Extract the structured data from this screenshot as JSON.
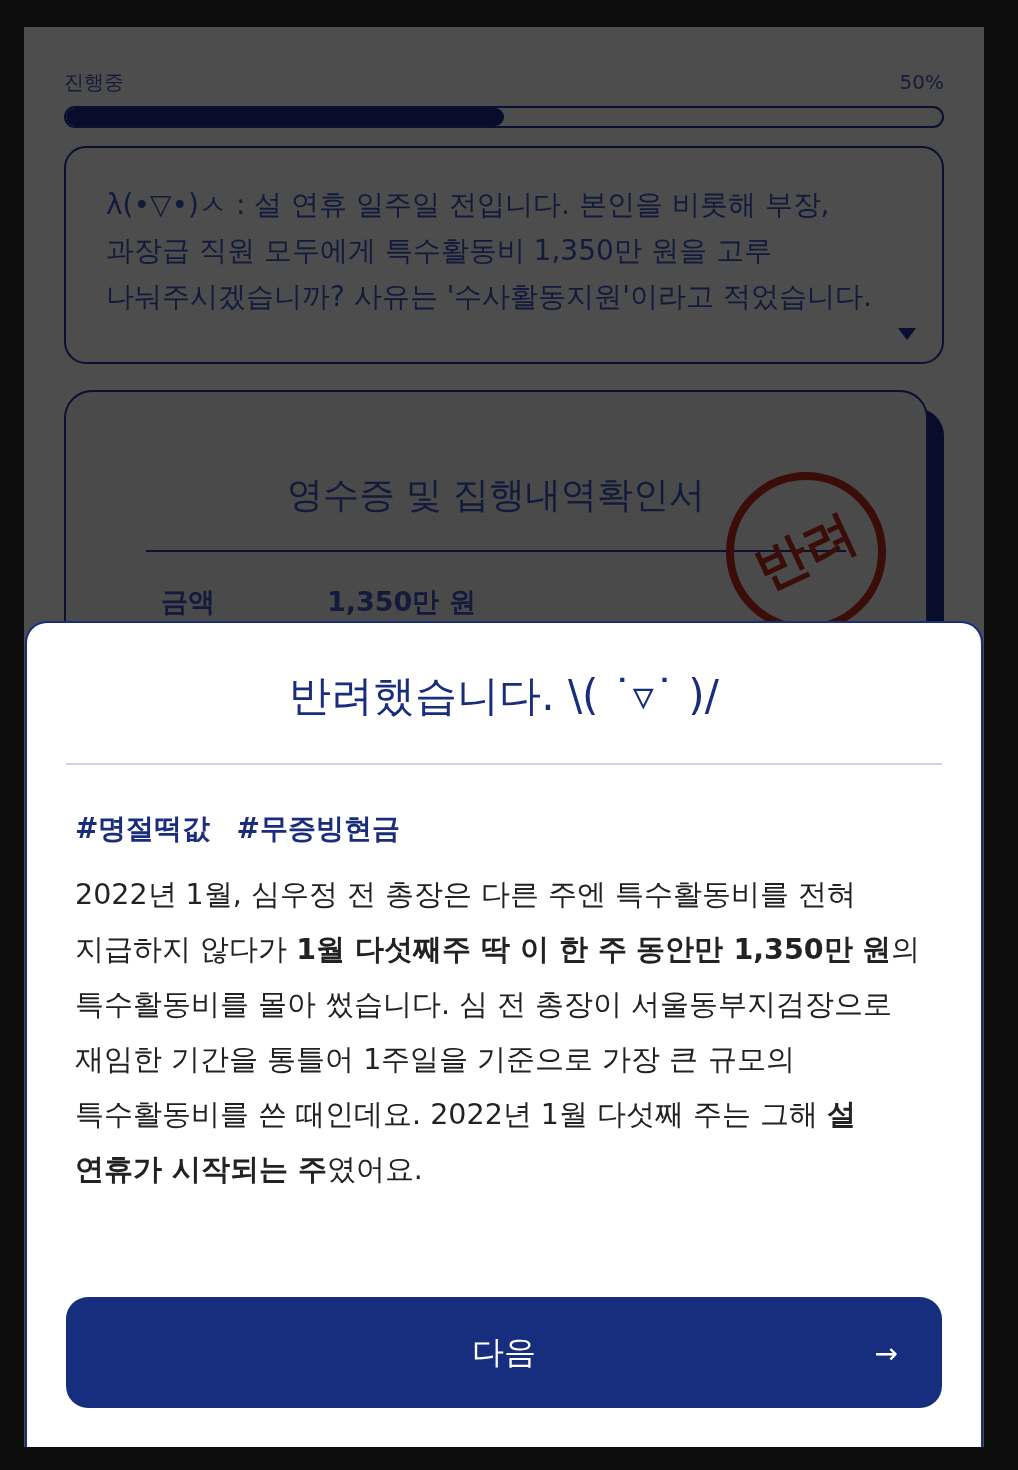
{
  "progress": {
    "label": "진행중",
    "reading": "50%",
    "level": 0.5
  },
  "dialog": {
    "text": "λ(•▽•)ㅅ : 설 연휴 일주일 전입니다. 본인을 비롯해 부장, 과장급 직원 모두에게 특수활동비 1,350만 원을 고루 나눠주시겠습니까? 사유는 '수사활동지원'이라고 적었습니다."
  },
  "receipt": {
    "title": "영수증 및 집행내역확인서",
    "rows": [
      {
        "label": "금액",
        "value": "1,350만 원"
      }
    ],
    "stamp": "반려"
  },
  "result_sheet": {
    "title": "반려했습니다. \\( ˙▿˙ )/",
    "tags": [
      "#명절떡값",
      "#무증빙현금"
    ],
    "body": "2022년 1월, 심우정 전 총장은 다른 주엔 특수활동비를 전혀 지급하지 않다가 **1월 다섯째주 딱 이 한 주 동안만 1,350만 원**의 특수활동비를 몰아 썼습니다. 심 전 총장이 서울동부지검장으로 재임한 기간을 통틀어 1주일을 기준으로 가장 큰 규모의 특수활동비를 쓴 때인데요. 2022년 1월 다섯째 주는 그해 **설 연휴가 시작되는 주**였어요.",
    "button": {
      "label": "다음",
      "icon": "→"
    }
  }
}
